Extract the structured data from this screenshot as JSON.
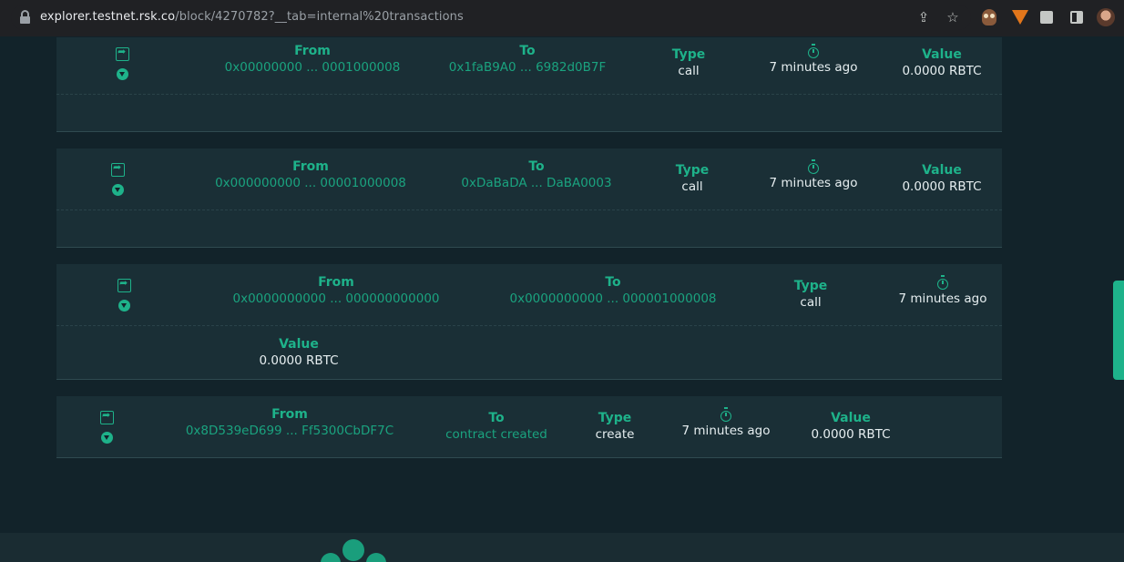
{
  "browser": {
    "url_host": "explorer.testnet.rsk.co",
    "url_path": "/block/4270782?__tab=internal%20transactions",
    "icons": [
      "lock-icon",
      "share-icon",
      "star-icon",
      "owl-extension-icon",
      "metamask-fox-icon",
      "puzzle-extensions-icon",
      "side-panel-icon",
      "profile-avatar"
    ]
  },
  "transactions": [
    {
      "from_label": "From",
      "from": "0x00000000 ... 0001000008",
      "to_label": "To",
      "to": "0x1faB9A0 ... 6982d0B7F",
      "type_label": "Type",
      "type": "call",
      "age": "7 minutes ago",
      "value_label": "Value",
      "value": "0.0000 RBTC"
    },
    {
      "from_label": "From",
      "from": "0x000000000 ... 00001000008",
      "to_label": "To",
      "to": "0xDaBaDA ... DaBA0003",
      "type_label": "Type",
      "type": "call",
      "age": "7 minutes ago",
      "value_label": "Value",
      "value": "0.0000 RBTC"
    },
    {
      "from_label": "From",
      "from": "0x0000000000 ... 000000000000",
      "to_label": "To",
      "to": "0x0000000000 ... 000001000008",
      "type_label": "Type",
      "type": "call",
      "age": "7 minutes ago",
      "value_label": "Value",
      "value": "0.0000 RBTC"
    },
    {
      "from_label": "From",
      "from": "0x8D539eD699 ... Ff5300CbDF7C",
      "to_label": "To",
      "to": "contract created",
      "type_label": "Type",
      "type": "create",
      "age": "7 minutes ago",
      "value_label": "Value",
      "value": "0.0000 RBTC"
    }
  ],
  "colors": {
    "accent": "#1eb28a",
    "background": "#12232a",
    "card": "#1a2f36"
  }
}
